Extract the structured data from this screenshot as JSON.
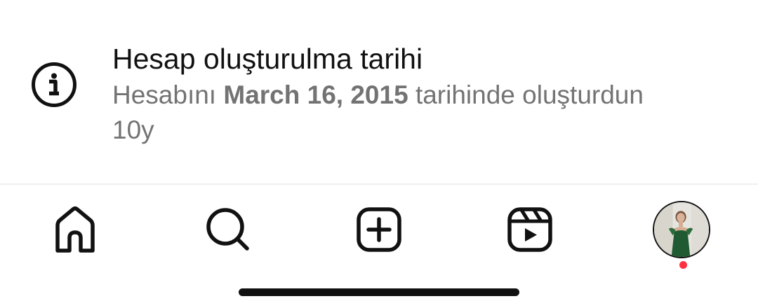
{
  "account_info": {
    "icon": "info-circle-icon",
    "title": "Hesap oluşturulma tarihi",
    "subtitle_prefix": "Hesabını ",
    "created_date": "March 16, 2015",
    "subtitle_suffix": " tarihinde oluşturdun",
    "age": "10y"
  },
  "tab_bar": {
    "items": [
      {
        "name": "home",
        "icon": "home-icon"
      },
      {
        "name": "search",
        "icon": "search-icon"
      },
      {
        "name": "create",
        "icon": "plus-square-icon"
      },
      {
        "name": "reels",
        "icon": "reels-icon"
      },
      {
        "name": "profile",
        "icon": "profile-avatar"
      }
    ],
    "profile_notification": true
  },
  "colors": {
    "text_primary": "#111111",
    "text_secondary": "#737373",
    "notification_dot": "#ff3040",
    "divider": "#efefef"
  }
}
